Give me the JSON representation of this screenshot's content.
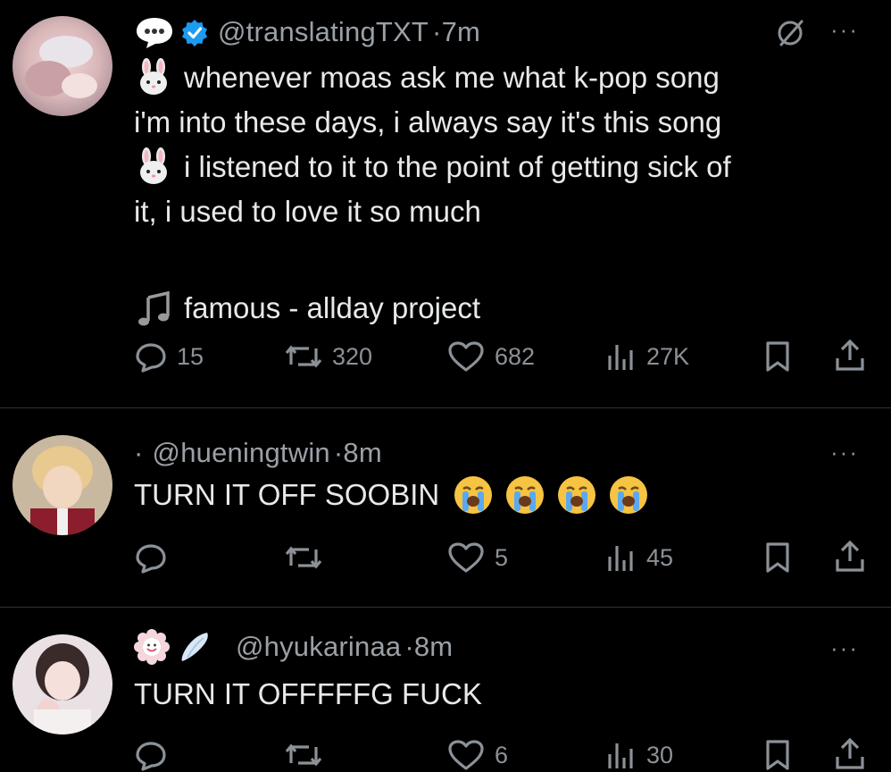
{
  "tweets": [
    {
      "handle": "@translatingTXT",
      "time": "7m",
      "lines": [
        "whenever moas ask me what k-pop song",
        "i'm into these days, i always say it's this song",
        "i listened to it to the point of getting sick of",
        "it, i used to love it so much"
      ],
      "song": "famous - allday project",
      "replies": "15",
      "retweets": "320",
      "likes": "682",
      "views": "27K"
    },
    {
      "dot": "·",
      "handle": "@hueningtwin",
      "time": "8m",
      "text": "TURN IT OFF SOOBIN",
      "replies": "",
      "retweets": "",
      "likes": "5",
      "views": "45"
    },
    {
      "handle": "@hyukarinaa",
      "time": "8m",
      "text": "TURN IT OFFFFFG FUCK",
      "likes": "6",
      "views": "30"
    }
  ],
  "separator": " · ",
  "more_label": "···",
  "colors": {
    "background": "#000000",
    "text": "#e7e9ea",
    "muted": "#8b9197",
    "verified": "#1d9bf0",
    "divider": "#2f3336"
  },
  "icons": [
    "speech-bubble-icon",
    "verified-badge-icon",
    "bunny-emoji-icon",
    "music-note-icon",
    "reply-icon",
    "retweet-icon",
    "like-icon",
    "views-icon",
    "bookmark-icon",
    "share-icon",
    "grok-icon",
    "crying-emoji-icon",
    "smiley-flower-icon",
    "wing-icon"
  ]
}
